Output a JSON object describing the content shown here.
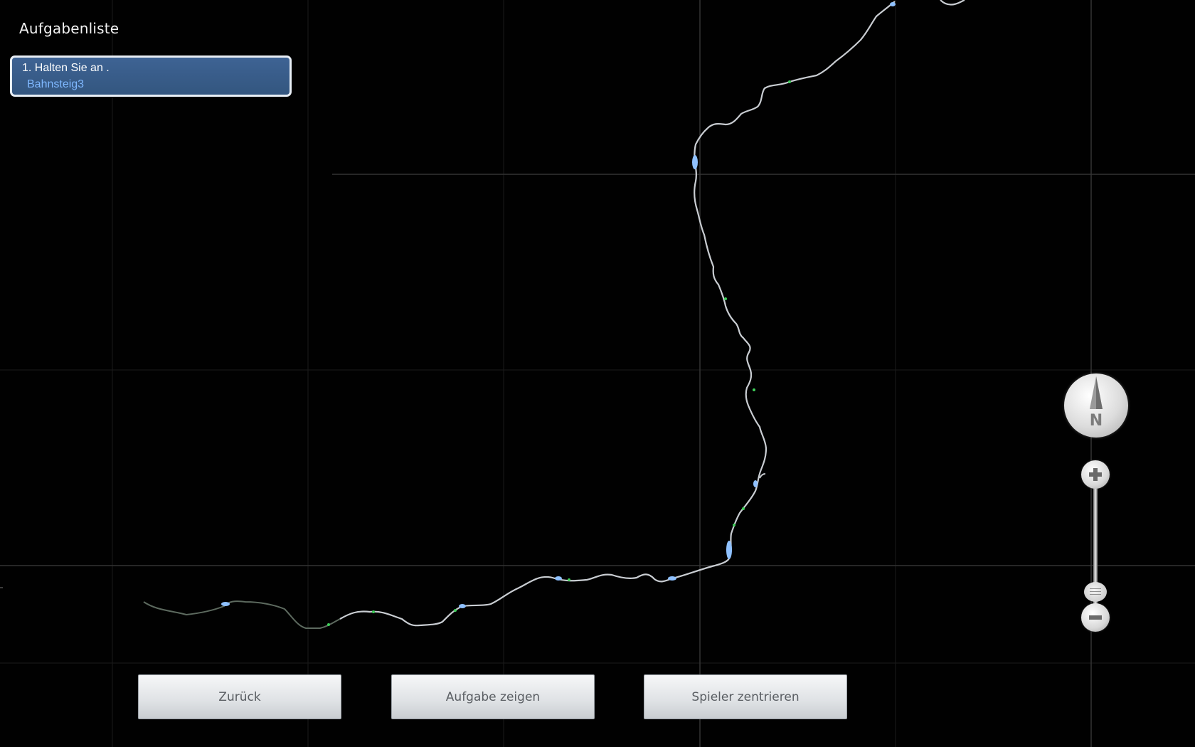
{
  "task_panel": {
    "header": "Aufgabenliste",
    "tasks": [
      {
        "instruction": "1. Halten Sie an  .",
        "target": "Bahnsteig3"
      }
    ]
  },
  "map": {
    "compass_label": "N",
    "track_color": "#c9cdd2",
    "station_marker_color": "#8fc1ff",
    "signal_marker_color": "#3fcf5a",
    "grid_color": "#2a2a2a"
  },
  "zoom": {
    "in_icon": "plus-icon",
    "out_icon": "minus-icon"
  },
  "buttons": {
    "back_label": "Zurück",
    "show_task_label": "Aufgabe zeigen",
    "center_player_label": "Spieler zentrieren"
  }
}
